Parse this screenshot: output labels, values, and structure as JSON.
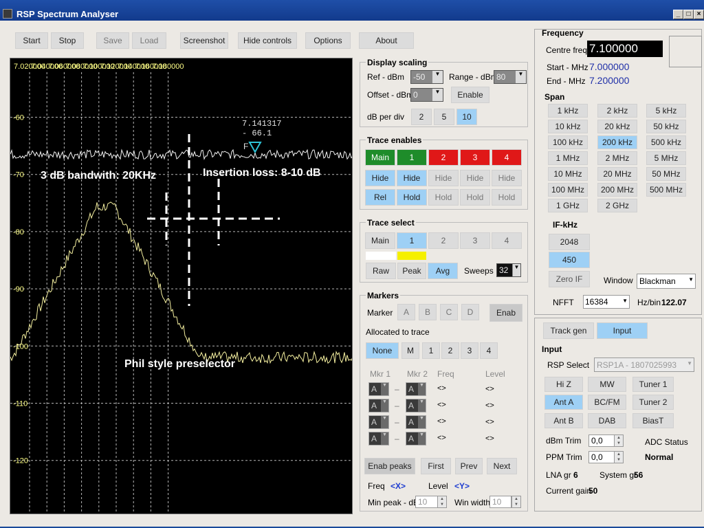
{
  "window": {
    "title": "RSP Spectrum Analyser"
  },
  "toolbar": {
    "start": "Start",
    "stop": "Stop",
    "save": "Save",
    "load": "Load",
    "screenshot": "Screenshot",
    "hide_controls": "Hide controls",
    "options": "Options",
    "about": "About"
  },
  "plot": {
    "freq_ticks": [
      "7.020000",
      "7.040000",
      "7.060000",
      "7.080000",
      "7.100000",
      "7.120000",
      "7.140000",
      "7.160000",
      "7.180000"
    ],
    "level_ticks": [
      "-60",
      "-70",
      "-80",
      "-90",
      "-100",
      "-110",
      "-120"
    ],
    "marker_freq": "7.141317",
    "marker_level": "- 66.1",
    "marker_tag": "F",
    "annotations": {
      "bandwidth": "3 dB bandwith: 20KHz",
      "loss": "Insertion loss: 8-10 dB",
      "caption": "Phil style preselector"
    },
    "colors": {
      "trace": "#f5f0a0",
      "grid": "#b8b8b8",
      "marker": "#2ec4d8",
      "text": "#ffff88"
    }
  },
  "display_scaling": {
    "title": "Display scaling",
    "ref_label": "Ref - dBm",
    "ref_value": "-50",
    "range_label": "Range - dBm",
    "range_value": "80",
    "offset_label": "Offset - dBm",
    "offset_value": "0",
    "enable": "Enable",
    "dbdiv_label": "dB per div",
    "dbdiv_options": [
      "2",
      "5",
      "10"
    ]
  },
  "trace_enables": {
    "title": "Trace enables",
    "names": [
      "Main",
      "1",
      "2",
      "3",
      "4"
    ],
    "hide": [
      "Hide",
      "Hide",
      "Hide",
      "Hide",
      "Hide"
    ],
    "hold": [
      "Rel",
      "Hold",
      "Hold",
      "Hold",
      "Hold"
    ]
  },
  "trace_select": {
    "title": "Trace select",
    "names": [
      "Main",
      "1",
      "2",
      "3",
      "4"
    ],
    "raw": "Raw",
    "peak": "Peak",
    "avg": "Avg",
    "sweeps_label": "Sweeps",
    "sweeps_value": "32"
  },
  "markers": {
    "title": "Markers",
    "marker_label": "Marker",
    "marker_buttons": [
      "A",
      "B",
      "C",
      "D"
    ],
    "enab": "Enab",
    "alloc_label": "Allocated to trace",
    "alloc_buttons": [
      "None",
      "M",
      "1",
      "2",
      "3",
      "4"
    ],
    "col_mkr1": "Mkr 1",
    "col_mkr2": "Mkr 2",
    "col_freq": "Freq",
    "col_level": "Level",
    "rows": [
      {
        "m1": "A",
        "m2": "A",
        "dash": "–",
        "freq": "<>",
        "level": "<>"
      },
      {
        "m1": "A",
        "m2": "A",
        "dash": "–",
        "freq": "<>",
        "level": "<>"
      },
      {
        "m1": "A",
        "m2": "A",
        "dash": "–",
        "freq": "<>",
        "level": "<>"
      },
      {
        "m1": "A",
        "m2": "A",
        "dash": "–",
        "freq": "<>",
        "level": "<>"
      }
    ],
    "enab_peaks": "Enab peaks",
    "first": "First",
    "prev": "Prev",
    "next": "Next",
    "freq_label": "Freq",
    "freq_val": "<X>",
    "level_label": "Level",
    "level_val": "<Y>",
    "min_peak_label": "Min peak - dB",
    "min_peak_value": "10",
    "win_width_label": "Win width",
    "win_width_value": "10"
  },
  "frequency": {
    "title": "Frequency",
    "centre_label": "Centre freq",
    "centre_value": "7.100000",
    "start_label": "Start - MHz",
    "start_value": "7.000000",
    "end_label": "End - MHz",
    "end_value": "7.200000"
  },
  "span": {
    "title": "Span",
    "buttons": [
      "1 kHz",
      "2 kHz",
      "5 kHz",
      "10 kHz",
      "20 kHz",
      "50 kHz",
      "100 kHz",
      "200 kHz",
      "500 kHz",
      "1 MHz",
      "2 MHz",
      "5 MHz",
      "10 MHz",
      "20 MHz",
      "50 MHz",
      "100 MHz",
      "200 MHz",
      "500 MHz",
      "1 GHz",
      "2 GHz"
    ],
    "selected": "200 kHz"
  },
  "if": {
    "title": "IF-kHz",
    "options": [
      "2048",
      "450"
    ],
    "zero_if": "Zero IF",
    "window_label": "Window",
    "window_value": "Blackman",
    "nfft_label": "NFFT",
    "nfft_value": "16384",
    "hzbin_label": "Hz/bin",
    "hzbin_value": "122.07"
  },
  "mode_tabs": {
    "track_gen": "Track gen",
    "input": "Input"
  },
  "input": {
    "title": "Input",
    "rsp_select_label": "RSP Select",
    "rsp_select_value": "RSP1A - 1807025993",
    "buttons": [
      "Hi Z",
      "MW",
      "Tuner 1",
      "Ant A",
      "BC/FM",
      "Tuner 2",
      "Ant B",
      "DAB",
      "BiasT"
    ],
    "dbm_trim_label": "dBm Trim",
    "dbm_trim_value": "0,0",
    "ppm_trim_label": "PPM Trim",
    "ppm_trim_value": "0,0",
    "adc_label": "ADC Status",
    "adc_value": "Normal",
    "lna_label": "LNA gr",
    "lna_value": "6",
    "sysgr_label": "System gr",
    "sysgr_value": "56",
    "curgain_label": "Current gain",
    "curgain_value": "50"
  }
}
